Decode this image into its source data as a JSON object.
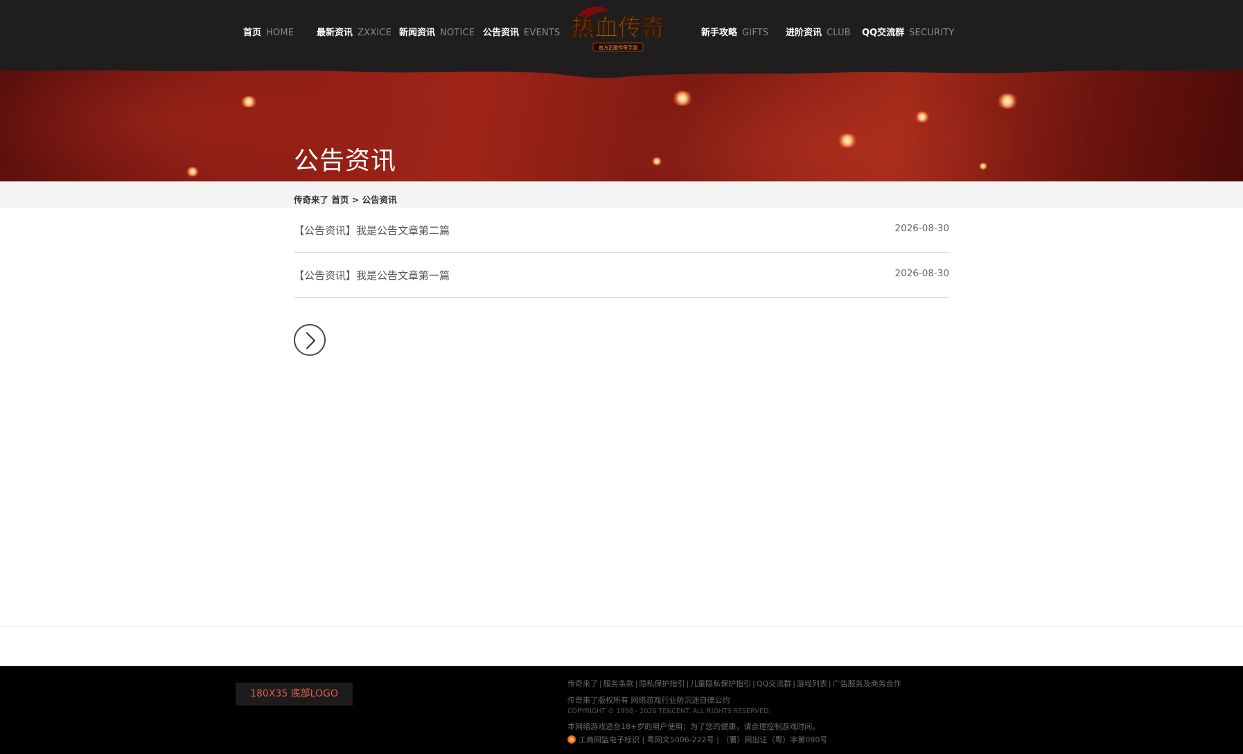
{
  "nav": {
    "items": [
      {
        "cn": "首页",
        "en": "HOME"
      },
      {
        "cn": "最新资讯",
        "en": "ZXXICE"
      },
      {
        "cn": "新闻资讯",
        "en": "NOTICE"
      },
      {
        "cn": "公告资讯",
        "en": "EVENTS"
      },
      {
        "cn": "新手攻略",
        "en": "GIFTS"
      },
      {
        "cn": "进阶资讯",
        "en": "CLUB"
      },
      {
        "cn": "QQ交流群",
        "en": "SECURITY"
      }
    ],
    "logo": {
      "main": "热血传奇",
      "sub": "官方正版传奇手游"
    }
  },
  "banner": {
    "title": "公告资讯"
  },
  "breadcrumb": {
    "site": "传奇来了",
    "home": "首页",
    "separator": ">",
    "current": "公告资讯"
  },
  "articles": [
    {
      "title": "【公告资讯】我是公告文章第二篇",
      "date": "2026-08-30"
    },
    {
      "title": "【公告资讯】我是公告文章第一篇",
      "date": "2026-08-30"
    }
  ],
  "pagination": {
    "next_icon": "chevron-right-icon"
  },
  "footer": {
    "logo_placeholder": "180X35 底部LOGO",
    "links": [
      "传奇来了",
      "服务条款",
      "隐私保护指引",
      "儿童隐私保护指引",
      "QQ交流群",
      "游戏列表",
      "广告服务及商务合作"
    ],
    "copyright_line": "传奇来了版权所有    网络游戏行业防沉迷自律公约",
    "copyright_en": "COPYRIGHT © 1998 - 2026 TENCENT. ALL RIGHTS RESERVED.",
    "age_notice": "本网络游戏适合18+岁的用户使用；为了您的健康，请合理控制游戏时间。",
    "license_line": "工商网监电子标识 | 粤网文5006-222号 | （署）网出证（粤）字第080号"
  },
  "colors": {
    "topbar_bg": "#1f1d1d",
    "nav_en": "#8f8b88",
    "banner_red": "#9f2417",
    "footer_bg": "#000000",
    "footer_logo_text": "#e2594f"
  }
}
